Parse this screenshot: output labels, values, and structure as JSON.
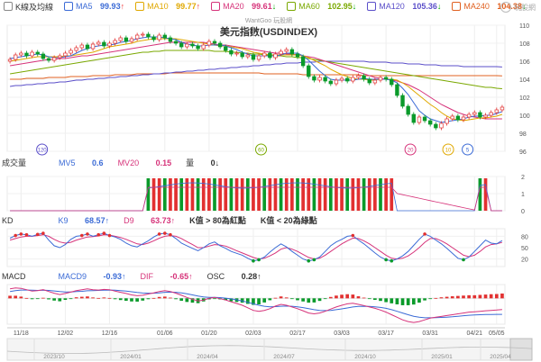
{
  "legend": {
    "items": [
      {
        "label": "K線及均線",
        "value": "",
        "dir": "",
        "color": "#888"
      },
      {
        "label": "MA5",
        "value": "99.93",
        "dir": "↑",
        "color": "#3b6bd6"
      },
      {
        "label": "MA10",
        "value": "99.77",
        "dir": "↑",
        "color": "#e0a800"
      },
      {
        "label": "MA20",
        "value": "99.61",
        "dir": "↓",
        "color": "#d6337a"
      },
      {
        "label": "MA60",
        "value": "102.95",
        "dir": "↓",
        "color": "#7aa800"
      },
      {
        "label": "MA120",
        "value": "105.36",
        "dir": "↓",
        "color": "#5b4fc9"
      },
      {
        "label": "MA240",
        "value": "104.38",
        "dir": "↓",
        "color": "#e06020"
      }
    ]
  },
  "logo_text": "玩股網",
  "watermark": "WantGoo 玩股網",
  "chart_title": "美元指數(USDINDEX)",
  "volume_legend": {
    "title": "成交量",
    "mv5_label": "MV5",
    "mv5": "0.6",
    "mv20_label": "MV20",
    "mv20": "0.15",
    "qty_label": "量",
    "qty": "0↓"
  },
  "kd_legend": {
    "title": "KD",
    "k_label": "K9",
    "k": "68.57↑",
    "d_label": "D9",
    "d": "63.73↑",
    "note1": "K值 > 80為紅點",
    "note2": "K值 < 20為綠點"
  },
  "macd_legend": {
    "title": "MACD",
    "macd_label": "MACD9",
    "macd": "-0.93↑",
    "dif_label": "DIF",
    "dif": "-0.65↑",
    "osc_label": "OSC",
    "osc": "0.28↑"
  },
  "markers": [
    {
      "label": "120",
      "color": "#5b4fc9",
      "at": 0.07
    },
    {
      "label": "60",
      "color": "#7aa800",
      "at": 0.51
    },
    {
      "label": "20",
      "color": "#d6337a",
      "at": 0.81
    },
    {
      "label": "10",
      "color": "#e0a800",
      "at": 0.886
    },
    {
      "label": "5",
      "color": "#3b6bd6",
      "at": 0.925
    }
  ],
  "chart_data": {
    "type": "line",
    "price_ylim": [
      96,
      110
    ],
    "price_yticks": [
      96,
      98,
      100,
      102,
      104,
      106,
      108,
      110
    ],
    "x_dates": [
      "11/18",
      "12/02",
      "12/16",
      "01/06",
      "01/20",
      "02/03",
      "02/17",
      "03/03",
      "03/17",
      "03/31",
      "04/21",
      "05/05"
    ],
    "nav_labels": [
      "2023/10",
      "2024/01",
      "2024/04",
      "2024/07",
      "2024/10",
      "2025/01",
      "2025/04"
    ],
    "close": [
      106.2,
      106.7,
      106.9,
      106.6,
      107.0,
      106.8,
      106.3,
      106.1,
      106.4,
      106.6,
      106.9,
      107.2,
      107.5,
      107.8,
      107.4,
      107.9,
      108.1,
      107.7,
      108.0,
      108.3,
      108.6,
      108.2,
      108.5,
      108.9,
      109.0,
      108.7,
      108.4,
      108.9,
      108.6,
      108.2,
      108.0,
      107.6,
      107.9,
      107.7,
      107.4,
      107.8,
      108.2,
      108.0,
      107.6,
      107.2,
      106.8,
      106.9,
      106.5,
      106.7,
      106.2,
      106.6,
      106.9,
      106.4,
      106.8,
      107.1,
      107.3,
      106.8,
      106.5,
      105.5,
      104.3,
      103.9,
      104.2,
      103.8,
      103.5,
      103.9,
      104.1,
      103.8,
      104.2,
      104.4,
      104.0,
      103.6,
      103.9,
      104.2,
      104.0,
      103.4,
      102.2,
      101.0,
      100.1,
      99.2,
      99.8,
      99.4,
      99.0,
      98.6,
      99.1,
      99.6,
      99.9,
      99.5,
      99.8,
      100.1,
      100.3,
      99.8,
      100.0,
      100.3,
      100.6,
      100.9
    ],
    "ma5": [
      106.3,
      106.4,
      106.5,
      106.6,
      106.7,
      106.8,
      106.7,
      106.5,
      106.4,
      106.4,
      106.5,
      106.6,
      106.9,
      107.2,
      107.4,
      107.6,
      107.7,
      107.8,
      107.8,
      107.9,
      108.1,
      108.2,
      108.3,
      108.5,
      108.6,
      108.7,
      108.7,
      108.7,
      108.6,
      108.5,
      108.4,
      108.1,
      107.9,
      107.8,
      107.7,
      107.7,
      107.8,
      107.8,
      107.8,
      107.7,
      107.5,
      107.3,
      107.0,
      106.8,
      106.6,
      106.6,
      106.6,
      106.6,
      106.6,
      106.7,
      106.9,
      106.9,
      106.9,
      106.6,
      106.1,
      105.5,
      104.9,
      104.4,
      104.0,
      103.9,
      103.9,
      103.9,
      103.9,
      104.0,
      104.1,
      104.0,
      104.0,
      104.0,
      104.0,
      103.9,
      103.6,
      103.0,
      102.3,
      101.4,
      100.5,
      100.0,
      99.6,
      99.4,
      99.2,
      99.3,
      99.4,
      99.5,
      99.6,
      99.8,
      99.9,
      99.9,
      100.0,
      100.0,
      100.2,
      100.4
    ],
    "ma10": [
      106.0,
      106.1,
      106.2,
      106.3,
      106.4,
      106.5,
      106.5,
      106.5,
      106.5,
      106.5,
      106.6,
      106.6,
      106.7,
      106.8,
      106.9,
      107.0,
      107.2,
      107.4,
      107.6,
      107.7,
      107.8,
      107.9,
      108.0,
      108.2,
      108.3,
      108.4,
      108.5,
      108.5,
      108.5,
      108.5,
      108.5,
      108.4,
      108.3,
      108.2,
      108.1,
      108.0,
      107.9,
      107.8,
      107.7,
      107.7,
      107.6,
      107.5,
      107.4,
      107.2,
      107.0,
      106.9,
      106.8,
      106.7,
      106.7,
      106.7,
      106.7,
      106.7,
      106.7,
      106.6,
      106.4,
      106.1,
      105.8,
      105.5,
      105.1,
      104.8,
      104.5,
      104.3,
      104.1,
      104.0,
      104.0,
      103.9,
      103.9,
      104.0,
      104.0,
      104.0,
      103.9,
      103.6,
      103.2,
      102.7,
      102.2,
      101.7,
      101.2,
      100.8,
      100.3,
      99.9,
      99.6,
      99.5,
      99.4,
      99.5,
      99.6,
      99.7,
      99.7,
      99.8,
      99.9,
      100.1
    ],
    "ma20": [
      105.5,
      105.6,
      105.7,
      105.8,
      105.9,
      106.0,
      106.1,
      106.2,
      106.2,
      106.3,
      106.3,
      106.4,
      106.5,
      106.6,
      106.6,
      106.7,
      106.8,
      106.9,
      107.0,
      107.1,
      107.2,
      107.3,
      107.4,
      107.5,
      107.6,
      107.7,
      107.8,
      107.9,
      108.0,
      108.1,
      108.1,
      108.1,
      108.1,
      108.1,
      108.1,
      108.1,
      108.0,
      107.9,
      107.8,
      107.8,
      107.7,
      107.6,
      107.5,
      107.4,
      107.3,
      107.2,
      107.1,
      107.0,
      106.9,
      106.9,
      106.8,
      106.8,
      106.7,
      106.6,
      106.5,
      106.4,
      106.2,
      106.0,
      105.8,
      105.6,
      105.4,
      105.2,
      105.0,
      104.8,
      104.6,
      104.4,
      104.2,
      104.1,
      104.0,
      103.9,
      103.8,
      103.6,
      103.4,
      103.1,
      102.8,
      102.4,
      102.0,
      101.6,
      101.2,
      100.9,
      100.6,
      100.3,
      100.1,
      99.9,
      99.8,
      99.7,
      99.6,
      99.6,
      99.6,
      99.6
    ],
    "ma60": [
      104.6,
      104.7,
      104.8,
      104.9,
      105.0,
      105.1,
      105.2,
      105.3,
      105.4,
      105.5,
      105.6,
      105.7,
      105.8,
      105.9,
      106.0,
      106.1,
      106.2,
      106.3,
      106.4,
      106.5,
      106.6,
      106.7,
      106.8,
      106.9,
      107.0,
      107.0,
      107.1,
      107.1,
      107.2,
      107.2,
      107.2,
      107.2,
      107.2,
      107.2,
      107.2,
      107.2,
      107.2,
      107.1,
      107.1,
      107.1,
      107.0,
      107.0,
      106.9,
      106.9,
      106.8,
      106.8,
      106.7,
      106.7,
      106.6,
      106.6,
      106.5,
      106.5,
      106.4,
      106.4,
      106.3,
      106.2,
      106.1,
      106.0,
      105.9,
      105.8,
      105.7,
      105.6,
      105.5,
      105.4,
      105.3,
      105.2,
      105.1,
      105.0,
      104.9,
      104.8,
      104.7,
      104.6,
      104.5,
      104.4,
      104.3,
      104.2,
      104.1,
      104.0,
      103.9,
      103.8,
      103.7,
      103.6,
      103.5,
      103.4,
      103.3,
      103.2,
      103.1,
      103.1,
      103.0,
      102.95
    ],
    "ma120": [
      103.2,
      103.3,
      103.3,
      103.4,
      103.4,
      103.5,
      103.5,
      103.6,
      103.6,
      103.7,
      103.7,
      103.8,
      103.9,
      103.9,
      104.0,
      104.0,
      104.1,
      104.1,
      104.2,
      104.2,
      104.3,
      104.3,
      104.4,
      104.4,
      104.5,
      104.5,
      104.6,
      104.6,
      104.7,
      104.7,
      104.8,
      104.8,
      104.9,
      104.9,
      105.0,
      105.0,
      105.1,
      105.1,
      105.2,
      105.2,
      105.3,
      105.3,
      105.4,
      105.4,
      105.5,
      105.5,
      105.6,
      105.6,
      105.7,
      105.7,
      105.8,
      105.8,
      105.8,
      105.9,
      105.9,
      105.9,
      106.0,
      106.0,
      106.0,
      106.0,
      106.0,
      106.0,
      106.0,
      106.0,
      106.0,
      105.9,
      105.9,
      105.9,
      105.9,
      105.8,
      105.8,
      105.8,
      105.7,
      105.7,
      105.7,
      105.6,
      105.6,
      105.6,
      105.5,
      105.5,
      105.5,
      105.5,
      105.4,
      105.4,
      105.4,
      105.4,
      105.4,
      105.4,
      105.4,
      105.36
    ],
    "ma240": [
      104.0,
      104.0,
      104.0,
      104.1,
      104.1,
      104.1,
      104.1,
      104.2,
      104.2,
      104.2,
      104.2,
      104.3,
      104.3,
      104.3,
      104.3,
      104.4,
      104.4,
      104.4,
      104.4,
      104.5,
      104.5,
      104.5,
      104.5,
      104.6,
      104.6,
      104.6,
      104.6,
      104.6,
      104.6,
      104.7,
      104.7,
      104.7,
      104.7,
      104.7,
      104.7,
      104.7,
      104.7,
      104.7,
      104.7,
      104.7,
      104.7,
      104.7,
      104.7,
      104.7,
      104.7,
      104.7,
      104.6,
      104.6,
      104.6,
      104.6,
      104.6,
      104.6,
      104.6,
      104.5,
      104.5,
      104.5,
      104.5,
      104.5,
      104.5,
      104.5,
      104.5,
      104.5,
      104.5,
      104.5,
      104.4,
      104.4,
      104.4,
      104.4,
      104.4,
      104.4,
      104.4,
      104.4,
      104.4,
      104.4,
      104.4,
      104.4,
      104.4,
      104.4,
      104.4,
      104.4,
      104.4,
      104.4,
      104.4,
      104.4,
      104.4,
      104.4,
      104.4,
      104.4,
      104.4,
      104.38
    ],
    "volume_ylim": [
      0,
      2
    ],
    "volume_yticks": [
      0,
      1,
      2
    ],
    "volume_bars": [
      0,
      0,
      0,
      0,
      0,
      0,
      0,
      0,
      0,
      0,
      0,
      0,
      0,
      0,
      0,
      0,
      0,
      0,
      0,
      0,
      0,
      0,
      0,
      0,
      0,
      0,
      0,
      0,
      0,
      0,
      0,
      0,
      0,
      0,
      0,
      0,
      0,
      0,
      0,
      0,
      0,
      0,
      0,
      0,
      0,
      0,
      0,
      0,
      0,
      0,
      0,
      0,
      0,
      0,
      0,
      0,
      0,
      0,
      0,
      0,
      0,
      0,
      0,
      0,
      0,
      0,
      0,
      0,
      0,
      0,
      0,
      0,
      0,
      0,
      0,
      0,
      0,
      0,
      0,
      0,
      0,
      0,
      0,
      0,
      0,
      0,
      0,
      0,
      0,
      0
    ],
    "volume_note": "volume bars only in windows",
    "volume_windows": [
      [
        0.28,
        0.77
      ],
      [
        0.945,
        0.965
      ]
    ],
    "kd_ylim": [
      0,
      100
    ],
    "kd_yticks": [
      20,
      50,
      80
    ],
    "k": [
      75,
      82,
      86,
      84,
      80,
      85,
      88,
      70,
      55,
      50,
      58,
      72,
      80,
      82,
      86,
      80,
      84,
      88,
      82,
      78,
      72,
      62,
      55,
      52,
      60,
      68,
      78,
      86,
      88,
      84,
      74,
      62,
      55,
      48,
      42,
      50,
      60,
      65,
      55,
      48,
      40,
      35,
      30,
      22,
      15,
      18,
      25,
      38,
      50,
      60,
      52,
      40,
      30,
      20,
      15,
      18,
      25,
      40,
      55,
      65,
      72,
      80,
      82,
      70,
      60,
      48,
      36,
      25,
      18,
      15,
      20,
      28,
      40,
      56,
      72,
      86,
      80,
      70,
      60,
      48,
      35,
      22,
      18,
      25,
      40,
      55,
      70,
      62,
      60,
      68.57
    ],
    "d": [
      70,
      74,
      78,
      80,
      80,
      82,
      84,
      80,
      72,
      65,
      62,
      64,
      70,
      74,
      78,
      79,
      81,
      84,
      83,
      80,
      77,
      72,
      66,
      60,
      58,
      62,
      68,
      75,
      80,
      82,
      80,
      74,
      66,
      58,
      50,
      50,
      54,
      58,
      57,
      54,
      48,
      42,
      36,
      30,
      24,
      20,
      22,
      28,
      36,
      46,
      50,
      46,
      40,
      32,
      24,
      20,
      22,
      30,
      40,
      50,
      60,
      68,
      75,
      74,
      68,
      60,
      50,
      40,
      30,
      22,
      20,
      22,
      28,
      38,
      50,
      64,
      74,
      74,
      68,
      60,
      50,
      40,
      30,
      26,
      30,
      40,
      52,
      58,
      60,
      63.73
    ],
    "macd_ylim": [
      -1.5,
      0.8
    ],
    "dif": [
      0.55,
      0.6,
      0.58,
      0.5,
      0.42,
      0.45,
      0.5,
      0.4,
      0.3,
      0.22,
      0.28,
      0.36,
      0.45,
      0.5,
      0.55,
      0.5,
      0.48,
      0.52,
      0.5,
      0.42,
      0.35,
      0.28,
      0.2,
      0.15,
      0.18,
      0.25,
      0.32,
      0.4,
      0.45,
      0.4,
      0.3,
      0.18,
      0.05,
      -0.05,
      -0.15,
      -0.1,
      0.0,
      0.05,
      -0.02,
      -0.1,
      -0.2,
      -0.3,
      -0.4,
      -0.55,
      -0.7,
      -0.75,
      -0.7,
      -0.6,
      -0.45,
      -0.35,
      -0.4,
      -0.5,
      -0.6,
      -0.72,
      -0.85,
      -0.9,
      -0.85,
      -0.75,
      -0.62,
      -0.5,
      -0.4,
      -0.32,
      -0.28,
      -0.35,
      -0.42,
      -0.5,
      -0.58,
      -0.68,
      -0.8,
      -0.95,
      -1.1,
      -1.25,
      -1.35,
      -1.4,
      -1.35,
      -1.25,
      -1.15,
      -1.1,
      -1.05,
      -1.0,
      -0.95,
      -0.9,
      -0.85,
      -0.8,
      -0.78,
      -0.75,
      -0.72,
      -0.7,
      -0.68,
      -0.65
    ],
    "macd": [
      0.4,
      0.45,
      0.48,
      0.48,
      0.47,
      0.46,
      0.47,
      0.46,
      0.43,
      0.39,
      0.37,
      0.37,
      0.39,
      0.41,
      0.44,
      0.45,
      0.46,
      0.47,
      0.48,
      0.47,
      0.45,
      0.42,
      0.38,
      0.34,
      0.31,
      0.3,
      0.3,
      0.32,
      0.35,
      0.36,
      0.35,
      0.32,
      0.26,
      0.2,
      0.13,
      0.08,
      0.06,
      0.06,
      0.04,
      0.01,
      -0.03,
      -0.09,
      -0.15,
      -0.23,
      -0.32,
      -0.4,
      -0.46,
      -0.49,
      -0.48,
      -0.46,
      -0.45,
      -0.46,
      -0.49,
      -0.54,
      -0.6,
      -0.66,
      -0.7,
      -0.71,
      -0.7,
      -0.66,
      -0.61,
      -0.56,
      -0.5,
      -0.47,
      -0.46,
      -0.47,
      -0.49,
      -0.53,
      -0.58,
      -0.66,
      -0.75,
      -0.85,
      -0.95,
      -1.04,
      -1.1,
      -1.13,
      -1.13,
      -1.12,
      -1.11,
      -1.09,
      -1.07,
      -1.04,
      -1.01,
      -0.98,
      -0.96,
      -0.95,
      -0.94,
      -0.94,
      -0.93,
      -0.93
    ]
  }
}
